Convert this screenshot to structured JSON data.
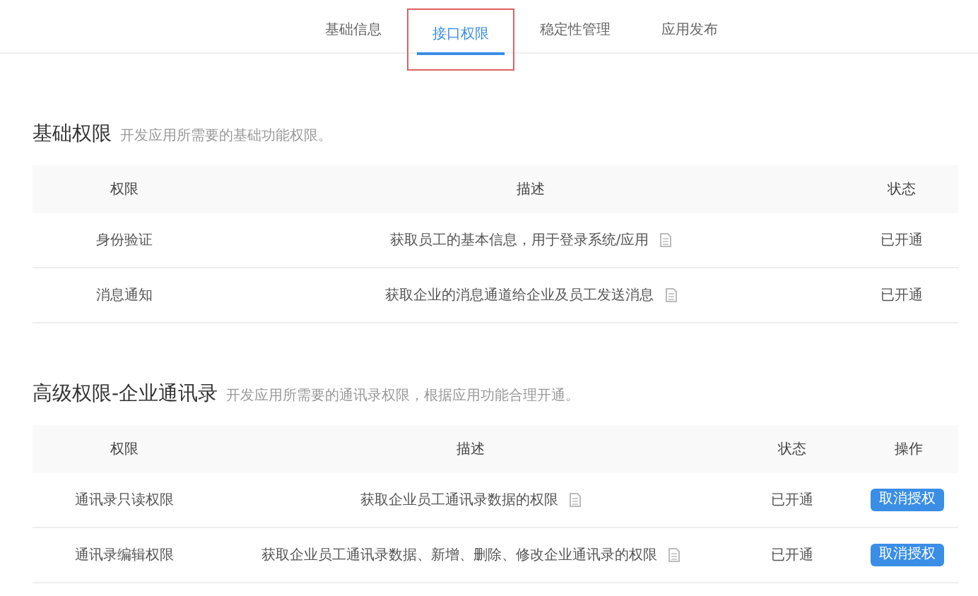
{
  "tabs": [
    {
      "label": "基础信息",
      "selected": false
    },
    {
      "label": "接口权限",
      "selected": true
    },
    {
      "label": "稳定性管理",
      "selected": false
    },
    {
      "label": "应用发布",
      "selected": false
    }
  ],
  "sections": [
    {
      "title": "基础权限",
      "subtitle": "开发应用所需要的基础功能权限。",
      "columns": [
        "权限",
        "描述",
        "状态"
      ],
      "rows": [
        {
          "permission": "身份验证",
          "description": "获取员工的基本信息，用于登录系统/应用",
          "status": "已开通"
        },
        {
          "permission": "消息通知",
          "description": "获取企业的消息通道给企业及员工发送消息",
          "status": "已开通"
        }
      ]
    },
    {
      "title": "高级权限-企业通讯录",
      "subtitle": "开发应用所需要的通讯录权限，根据应用功能合理开通。",
      "columns": [
        "权限",
        "描述",
        "状态",
        "操作"
      ],
      "rows": [
        {
          "permission": "通讯录只读权限",
          "description": "获取企业员工通讯录数据的权限",
          "status": "已开通",
          "action": "取消授权"
        },
        {
          "permission": "通讯录编辑权限",
          "description": "获取企业员工通讯录数据、新增、删除、修改企业通讯录的权限",
          "status": "已开通",
          "action": "取消授权"
        }
      ]
    }
  ]
}
